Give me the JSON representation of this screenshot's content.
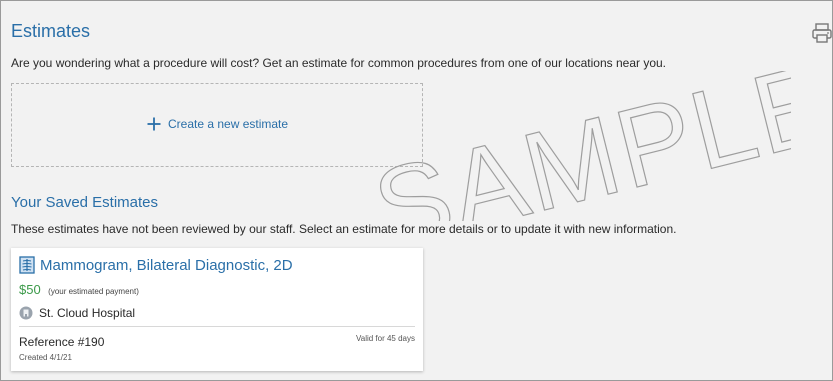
{
  "page": {
    "title": "Estimates",
    "intro": "Are you wondering what a procedure will cost? Get an estimate for common procedures from one of our locations near you.",
    "print_icon": "printer-icon"
  },
  "create": {
    "label": "Create a new estimate",
    "icon": "plus-icon"
  },
  "watermark": {
    "text": "SAMPLE"
  },
  "saved": {
    "title": "Your Saved Estimates",
    "description": "These estimates have not been reviewed by our staff. Select an estimate for more details or to update it with new information."
  },
  "estimates": [
    {
      "procedure": "Mammogram, Bilateral Diagnostic, 2D",
      "price": "$50",
      "price_note": "(your estimated payment)",
      "location": "St. Cloud Hospital",
      "reference": "Reference #190",
      "valid": "Valid for 45 days",
      "created": "Created 4/1/21",
      "procedure_icon": "xray-icon",
      "location_icon": "hospital-icon"
    }
  ],
  "colors": {
    "accent": "#2a6fa8",
    "price": "#3c9a4a",
    "background": "#f2f2f2"
  }
}
